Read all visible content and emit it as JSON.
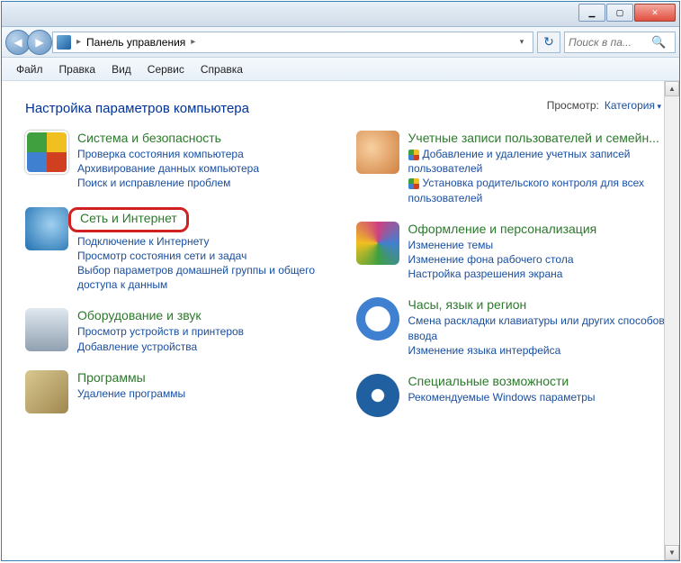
{
  "titlebar": {
    "min": "▁",
    "max": "▢",
    "close": "✕"
  },
  "nav": {
    "back": "◀",
    "fwd": "▶",
    "breadcrumb": "Панель управления",
    "arrow": "▸",
    "refresh": "↻"
  },
  "search": {
    "placeholder": "Поиск в па..."
  },
  "menu": [
    "Файл",
    "Правка",
    "Вид",
    "Сервис",
    "Справка"
  ],
  "content": {
    "heading": "Настройка параметров компьютера",
    "view_label": "Просмотр:",
    "view_value": "Категория"
  },
  "left": [
    {
      "key": "security",
      "title": "Система и безопасность",
      "links": [
        "Проверка состояния компьютера",
        "Архивирование данных компьютера",
        "Поиск и исправление проблем"
      ]
    },
    {
      "key": "network",
      "highlight": true,
      "title": "Сеть и Интернет",
      "links": [
        "Подключение к Интернету",
        "Просмотр состояния сети и задач",
        "Выбор параметров домашней группы и общего доступа к данным"
      ]
    },
    {
      "key": "hardware",
      "title": "Оборудование и звук",
      "links": [
        "Просмотр устройств и принтеров",
        "Добавление устройства"
      ]
    },
    {
      "key": "programs",
      "title": "Программы",
      "links": [
        "Удаление программы"
      ]
    }
  ],
  "right": [
    {
      "key": "users",
      "title": "Учетные записи пользователей и семейн...",
      "links": [
        "Добавление и удаление учетных записей пользователей",
        "Установка родительского контроля для всех пользователей"
      ],
      "shields": [
        true,
        true
      ]
    },
    {
      "key": "appearance",
      "title": "Оформление и персонализация",
      "links": [
        "Изменение темы",
        "Изменение фона рабочего стола",
        "Настройка разрешения экрана"
      ]
    },
    {
      "key": "clock",
      "title": "Часы, язык и регион",
      "links": [
        "Смена раскладки клавиатуры или других способов ввода",
        "Изменение языка интерфейса"
      ]
    },
    {
      "key": "access",
      "title": "Специальные возможности",
      "links": [
        "Рекомендуемые Windows параметры"
      ]
    }
  ],
  "scrollbar": {
    "up": "▲",
    "down": "▼"
  }
}
